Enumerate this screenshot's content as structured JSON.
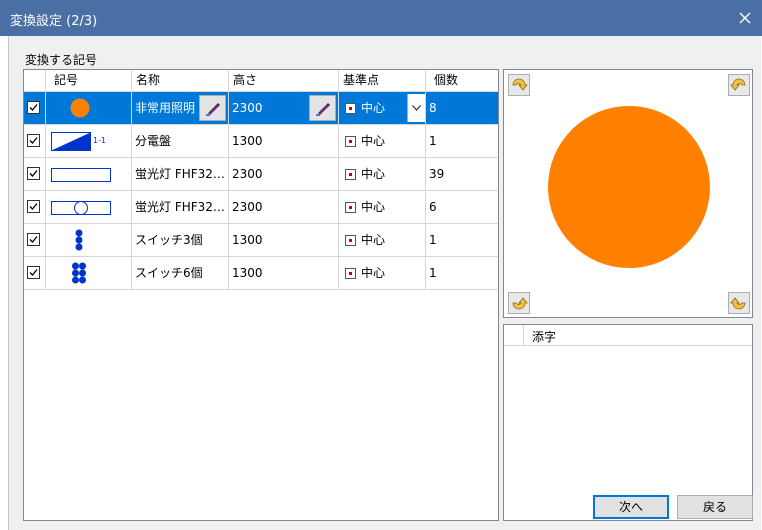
{
  "window": {
    "title": "変換設定 (2/3)"
  },
  "section_label": "変換する記号",
  "table": {
    "headers": [
      "記号",
      "名称",
      "高さ",
      "基準点",
      "個数"
    ],
    "rows": [
      {
        "checked": true,
        "symbol": "orange-circle-symbol",
        "name": "非常用照明",
        "height": "2300",
        "base": "中心",
        "count": "8",
        "selected": true
      },
      {
        "checked": true,
        "symbol": "distribution-panel-symbol",
        "symbol_label": "1-1",
        "name": "分電盤",
        "height": "1300",
        "base": "中心",
        "count": "1"
      },
      {
        "checked": true,
        "symbol": "fluorescent-symbol",
        "name": "蛍光灯 FHF32…",
        "height": "2300",
        "base": "中心",
        "count": "39"
      },
      {
        "checked": true,
        "symbol": "fluorescent-circle-symbol",
        "name": "蛍光灯 FHF32…",
        "height": "2300",
        "base": "中心",
        "count": "6"
      },
      {
        "checked": true,
        "symbol": "switch-3-symbol",
        "name": "スイッチ3個",
        "height": "1300",
        "base": "中心",
        "count": "1"
      },
      {
        "checked": true,
        "symbol": "switch-6-symbol",
        "name": "スイッチ6個",
        "height": "1300",
        "base": "中心",
        "count": "1"
      }
    ]
  },
  "suffix": {
    "header": "添字"
  },
  "buttons": {
    "next": "次へ",
    "back": "戻る"
  },
  "colors": {
    "titlebar": "#4a6fa5",
    "selection": "#0078d7",
    "symbol_orange": "#ff8000",
    "symbol_blue": "#0033cc"
  }
}
